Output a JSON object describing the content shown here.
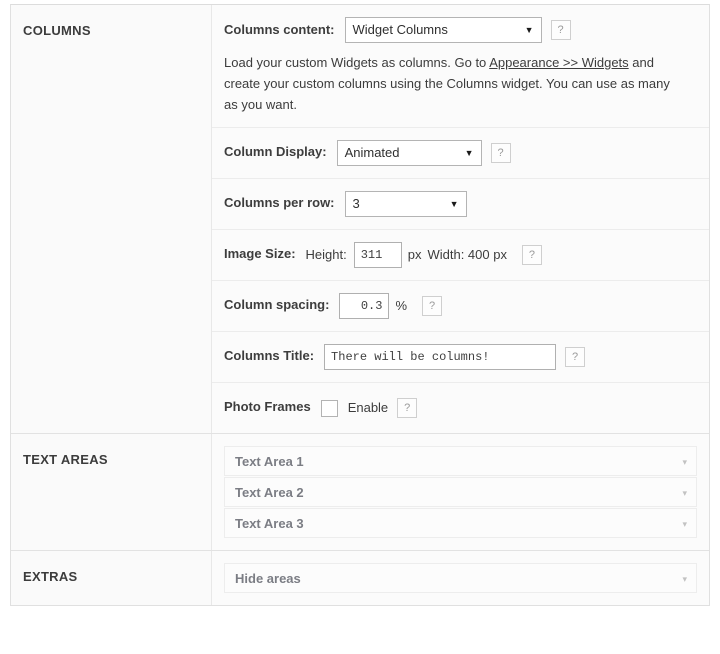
{
  "sections": [
    {
      "title": "COLUMNS",
      "rows": [
        {
          "label": "Columns content:",
          "select_value": "Widget Columns",
          "help": "?",
          "description_before": "Load your custom Widgets as columns. Go to ",
          "description_link": "Appearance >> Widgets",
          "description_after": " and create your custom columns using the Columns widget. You can use as many as you want."
        },
        {
          "label": "Column Display:",
          "select_value": "Animated",
          "help": "?"
        },
        {
          "label": "Columns per row:",
          "select_value": "3"
        },
        {
          "label": "Image Size:",
          "height_label": "Height:",
          "height_value": "311",
          "height_unit": "px",
          "width_text": "Width: 400 px",
          "help": "?"
        },
        {
          "label": "Column spacing:",
          "spacing_value": "0.3",
          "spacing_unit": "%",
          "help": "?"
        },
        {
          "label": "Columns Title:",
          "title_value": "There will be columns!",
          "title_placeholder": "",
          "help": "?"
        },
        {
          "label": "Photo Frames",
          "checkbox_label": "Enable",
          "checkbox_checked": false,
          "help": "?"
        }
      ]
    },
    {
      "title": "TEXT AREAS",
      "panels": [
        {
          "label": "Text Area 1"
        },
        {
          "label": "Text Area 2"
        },
        {
          "label": "Text Area 3"
        }
      ]
    },
    {
      "title": "EXTRAS",
      "panels": [
        {
          "label": "Hide areas"
        }
      ]
    }
  ],
  "icons": {
    "caret_down": "▼",
    "caret_down_light": "▾"
  },
  "colors": {
    "panel_bg": "#fafafa",
    "body_bg": "#fbfbfb",
    "border": "#e0e0e0",
    "row_border": "#ececec",
    "label_text": "#3d3d3d",
    "accordion_text": "#7b7d84",
    "help_text": "#9a9a9a"
  }
}
